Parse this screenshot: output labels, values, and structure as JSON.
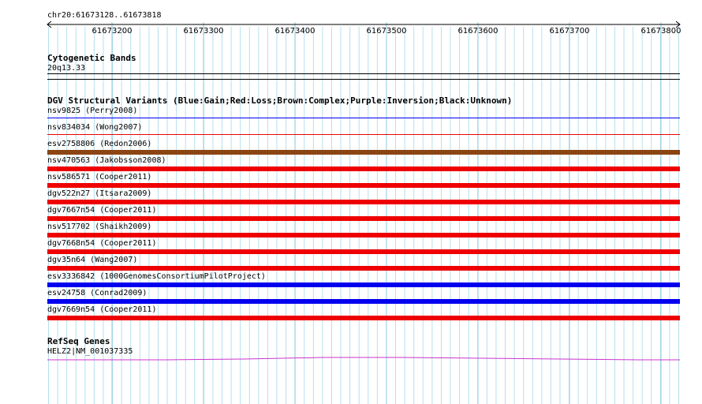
{
  "ruler": {
    "range_label": "chr20:61673128..61673818",
    "ticks": [
      "61673200",
      "61673300",
      "61673400",
      "61673500",
      "61673600",
      "61673700",
      "61673800"
    ]
  },
  "cytoband": {
    "title": "Cytogenetic Bands",
    "band": "20q13.33"
  },
  "dgv": {
    "title": "DGV Structural Variants (Blue:Gain;Red:Loss;Brown:Complex;Purple:Inversion;Black:Unknown)",
    "colors": {
      "gain": "#0000ee",
      "loss": "#ee0000",
      "complex": "#8b4513"
    },
    "variants": [
      {
        "label": "nsv9825 (Perry2008)",
        "type": "gain"
      },
      {
        "label": "nsv834034 (Wong2007)",
        "type": "loss"
      },
      {
        "label": "esv2758806 (Redon2006)",
        "type": "complex"
      },
      {
        "label": "nsv470563 (Jakobsson2008)",
        "type": "loss"
      },
      {
        "label": "nsv586571 (Cooper2011)",
        "type": "loss"
      },
      {
        "label": "dgv522n27 (Itsara2009)",
        "type": "loss"
      },
      {
        "label": "dgv7667n54 (Cooper2011)",
        "type": "loss"
      },
      {
        "label": "nsv517702 (Shaikh2009)",
        "type": "loss"
      },
      {
        "label": "dgv7668n54 (Cooper2011)",
        "type": "loss"
      },
      {
        "label": "dgv35n64 (Wang2007)",
        "type": "loss"
      },
      {
        "label": "esv3336842 (1000GenomesConsortiumPilotProject)",
        "type": "gain"
      },
      {
        "label": "esv24758 (Conrad2009)",
        "type": "gain"
      },
      {
        "label": "dgv7669n54 (Cooper2011)",
        "type": "loss"
      }
    ]
  },
  "refseq": {
    "title": "RefSeq Genes",
    "gene": "HELZ2|NM_001037335",
    "color": "#cc33cc"
  }
}
